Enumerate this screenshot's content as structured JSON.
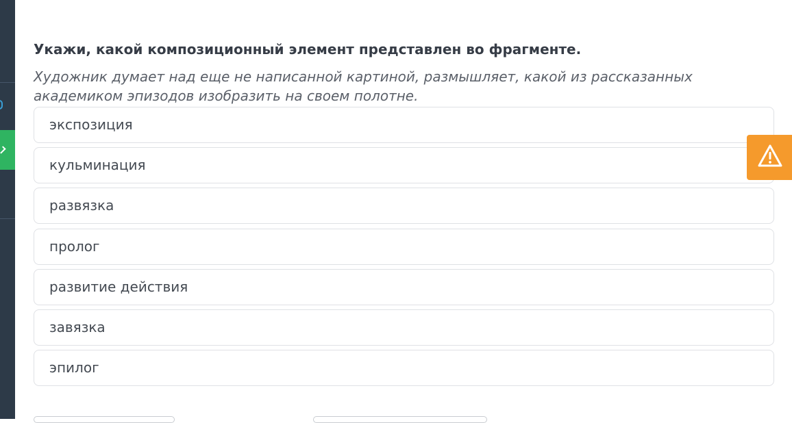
{
  "question": {
    "title": "Укажи, какой композиционный элемент представлен во фрагменте.",
    "fragment": "Художник думает над еще не написанной картиной, размышляет, какой из рассказанных академиком эпизодов изобразить на своем полотне."
  },
  "options": [
    {
      "label": "экспозиция"
    },
    {
      "label": "кульминация"
    },
    {
      "label": "развязка"
    },
    {
      "label": "пролог"
    },
    {
      "label": "развитие действия"
    },
    {
      "label": "завязка"
    },
    {
      "label": "эпилог"
    }
  ],
  "report_button": {
    "icon": "warning-icon",
    "color": "#f59a2c"
  },
  "colors": {
    "sidebar": "#2d3a48",
    "sidebar_active": "#2fb461"
  }
}
